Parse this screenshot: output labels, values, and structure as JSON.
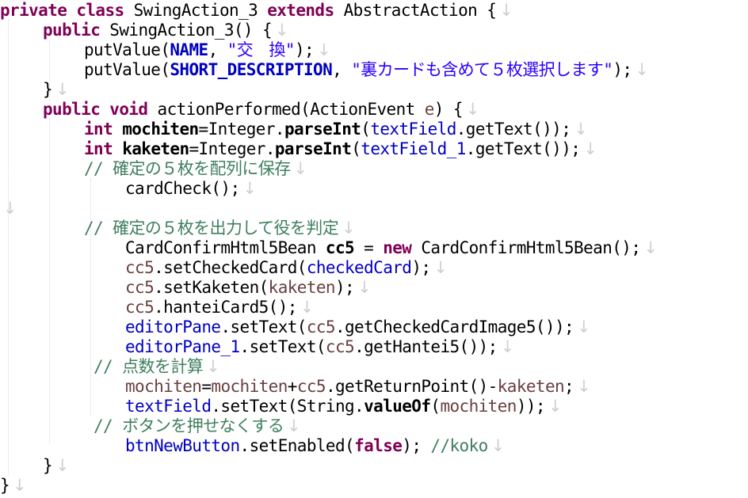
{
  "editor": {
    "eol_marker": "↓",
    "lines": [
      [
        {
          "t": "private class",
          "c": "kw"
        },
        {
          "t": " SwingAction_3 "
        },
        {
          "t": "extends",
          "c": "kw"
        },
        {
          "t": " AbstractAction {"
        }
      ],
      [
        {
          "t": "public",
          "c": "kw"
        },
        {
          "t": " SwingAction_3() {"
        }
      ],
      [
        {
          "t": "putValue("
        },
        {
          "t": "NAME",
          "c": "const"
        },
        {
          "t": ", "
        },
        {
          "t": "\"交　換\"",
          "c": "str"
        },
        {
          "t": ");"
        }
      ],
      [
        {
          "t": "putValue("
        },
        {
          "t": "SHORT_DESCRIPTION",
          "c": "const"
        },
        {
          "t": ", "
        },
        {
          "t": "\"裏カードも含めて５枚選択します\"",
          "c": "str"
        },
        {
          "t": ");"
        }
      ],
      [
        {
          "t": "}"
        }
      ],
      [
        {
          "t": "public void",
          "c": "kw"
        },
        {
          "t": " actionPerformed(ActionEvent "
        },
        {
          "t": "e",
          "c": "local"
        },
        {
          "t": ") {"
        }
      ],
      [
        {
          "t": "int",
          "c": "kw"
        },
        {
          "t": " "
        },
        {
          "t": "mochiten",
          "c": "localb"
        },
        {
          "t": "=Integer."
        },
        {
          "t": "parseInt",
          "c": "static"
        },
        {
          "t": "("
        },
        {
          "t": "textField",
          "c": "field"
        },
        {
          "t": ".getText());"
        }
      ],
      [
        {
          "t": "int",
          "c": "kw"
        },
        {
          "t": " "
        },
        {
          "t": "kaketen",
          "c": "localb"
        },
        {
          "t": "=Integer."
        },
        {
          "t": "parseInt",
          "c": "static"
        },
        {
          "t": "("
        },
        {
          "t": "textField_1",
          "c": "field"
        },
        {
          "t": ".getText());"
        }
      ],
      [
        {
          "t": "// 確定の５枚を配列に保存",
          "c": "cmt"
        }
      ],
      [
        {
          "t": "cardCheck();"
        }
      ],
      [],
      [
        {
          "t": "// 確定の５枚を出力して役を判定",
          "c": "cmt"
        }
      ],
      [
        {
          "t": "CardConfirmHtml5Bean "
        },
        {
          "t": "cc5",
          "c": "localb"
        },
        {
          "t": " = "
        },
        {
          "t": "new",
          "c": "kw"
        },
        {
          "t": " CardConfirmHtml5Bean();"
        }
      ],
      [
        {
          "t": "cc5",
          "c": "local"
        },
        {
          "t": ".setCheckedCard("
        },
        {
          "t": "checkedCard",
          "c": "field"
        },
        {
          "t": ");"
        }
      ],
      [
        {
          "t": "cc5",
          "c": "local"
        },
        {
          "t": ".setKaketen("
        },
        {
          "t": "kaketen",
          "c": "local"
        },
        {
          "t": ");"
        }
      ],
      [
        {
          "t": "cc5",
          "c": "local"
        },
        {
          "t": ".hanteiCard5();"
        }
      ],
      [
        {
          "t": "editorPane",
          "c": "field"
        },
        {
          "t": ".setText("
        },
        {
          "t": "cc5",
          "c": "local"
        },
        {
          "t": ".getCheckedCardImage5());"
        }
      ],
      [
        {
          "t": "editorPane_1",
          "c": "field"
        },
        {
          "t": ".setText("
        },
        {
          "t": "cc5",
          "c": "local"
        },
        {
          "t": ".getHantei5());"
        }
      ],
      [
        {
          "t": "// 点数を計算",
          "c": "cmt"
        }
      ],
      [
        {
          "t": "mochiten",
          "c": "local"
        },
        {
          "t": "="
        },
        {
          "t": "mochiten",
          "c": "local"
        },
        {
          "t": "+"
        },
        {
          "t": "cc5",
          "c": "local"
        },
        {
          "t": ".getReturnPoint()-"
        },
        {
          "t": "kaketen",
          "c": "local"
        },
        {
          "t": ";"
        }
      ],
      [
        {
          "t": "textField",
          "c": "field"
        },
        {
          "t": ".setText(String."
        },
        {
          "t": "valueOf",
          "c": "static"
        },
        {
          "t": "("
        },
        {
          "t": "mochiten",
          "c": "local"
        },
        {
          "t": "));"
        }
      ],
      [
        {
          "t": "// ボタンを押せなくする",
          "c": "cmt"
        }
      ],
      [
        {
          "t": "btnNewButton",
          "c": "field"
        },
        {
          "t": ".setEnabled("
        },
        {
          "t": "false",
          "c": "kw"
        },
        {
          "t": "); "
        },
        {
          "t": "//koko",
          "c": "cmt"
        }
      ],
      [
        {
          "t": "}"
        }
      ],
      [
        {
          "t": "}"
        }
      ]
    ]
  }
}
